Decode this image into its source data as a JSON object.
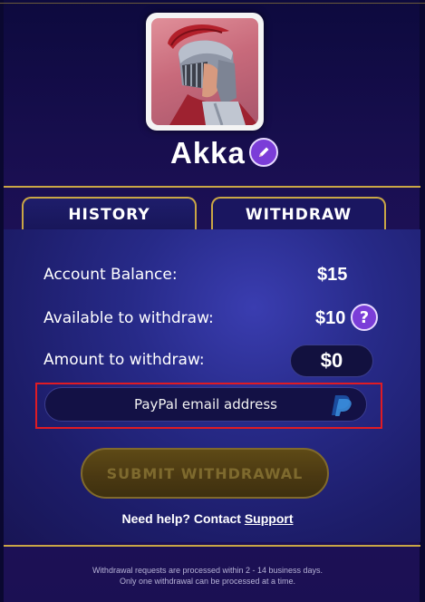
{
  "profile": {
    "username": "Akka",
    "avatar_icon": "gladiator-avatar",
    "edit_icon": "pencil-icon"
  },
  "tabs": [
    {
      "label": "HISTORY",
      "active": false
    },
    {
      "label": "WITHDRAW",
      "active": true
    }
  ],
  "withdraw": {
    "balance_label": "Account Balance:",
    "balance_value": "$15",
    "available_label": "Available to withdraw:",
    "available_value": "$10",
    "help_glyph": "?",
    "amount_label": "Amount to withdraw:",
    "amount_value": "$0",
    "email_placeholder": "PayPal email address",
    "email_value": "",
    "paypal_icon": "paypal-icon",
    "submit_label": "SUBMIT WITHDRAWAL",
    "submit_enabled": false
  },
  "help": {
    "prefix": "Need help? Contact ",
    "link": "Support"
  },
  "footer": {
    "line1": "Withdrawal requests are processed within 2 - 14 business days.",
    "line2": "Only one withdrawal can be processed at a time."
  },
  "colors": {
    "background": "#1d1052",
    "gold_border": "#c9a646",
    "accent_purple": "#7b3dd8",
    "highlight_red": "#e01b24",
    "submit_disabled": "#4b3912"
  }
}
